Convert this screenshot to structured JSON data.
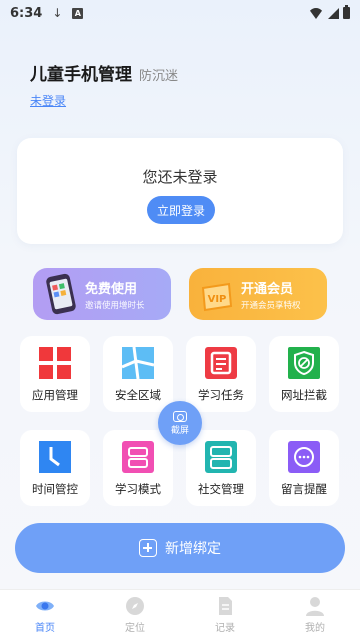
{
  "status_bar": {
    "time": "6:34",
    "download_icon": "↓",
    "notification_icon": "A"
  },
  "header": {
    "title": "儿童手机管理",
    "subtitle": "防沉迷",
    "login_link": "未登录"
  },
  "login_card": {
    "prompt": "您还未登录",
    "button": "立即登录"
  },
  "promos": [
    {
      "title": "免费使用",
      "desc": "邀请使用增时长",
      "color": "#a9a3f5"
    },
    {
      "title": "开通会员",
      "desc": "开通会员享特权",
      "color": "#fbb843"
    }
  ],
  "features": [
    {
      "label": "应用管理",
      "icon": "app-grid-icon",
      "color": "#f0383b"
    },
    {
      "label": "安全区域",
      "icon": "map-area-icon",
      "color": "#38a6f0"
    },
    {
      "label": "学习任务",
      "icon": "task-doc-icon",
      "color": "#ee3b44"
    },
    {
      "label": "网址拦截",
      "icon": "shield-block-icon",
      "color": "#22b14c"
    },
    {
      "label": "时间管控",
      "icon": "clock-icon",
      "color": "#2f86f2"
    },
    {
      "label": "学习模式",
      "icon": "study-mode-icon",
      "color": "#f14fb3"
    },
    {
      "label": "社交管理",
      "icon": "social-icon",
      "color": "#22b5b0"
    },
    {
      "label": "留言提醒",
      "icon": "message-icon",
      "color": "#8b5cf6"
    }
  ],
  "fab": {
    "label": "截屏"
  },
  "add_binding": {
    "label": "新增绑定"
  },
  "tabs": [
    {
      "label": "首页",
      "icon": "eye-icon"
    },
    {
      "label": "定位",
      "icon": "compass-icon"
    },
    {
      "label": "记录",
      "icon": "record-icon"
    },
    {
      "label": "我的",
      "icon": "user-icon"
    }
  ],
  "colors": {
    "accent": "#4f8cf5",
    "button": "#6fa0f7",
    "tab_active": "#4a86f7"
  }
}
